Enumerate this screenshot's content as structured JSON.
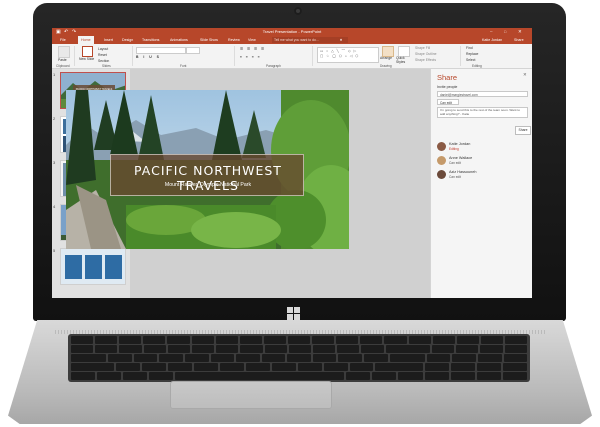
{
  "window": {
    "title": "Travel Presentation - PowerPoint",
    "user": "Katie Jordan",
    "share_label": "Share"
  },
  "tabs": [
    "File",
    "Home",
    "Insert",
    "Design",
    "Transitions",
    "Animations",
    "Slide Show",
    "Review",
    "View"
  ],
  "active_tab": "Home",
  "tell_me": {
    "placeholder": "Tell me what you want to do..."
  },
  "ribbon": {
    "paste": "Paste",
    "new_slide": "New Slide",
    "layout": "Layout",
    "reset": "Reset",
    "section": "Section",
    "arrange": "Arrange",
    "quick_styles": "Quick Styles",
    "shape_fill": "Shape Fill",
    "shape_outline": "Shape Outline",
    "shape_effects": "Shape Effects",
    "find": "Find",
    "replace": "Replace",
    "select": "Select",
    "groups": [
      "Clipboard",
      "Slides",
      "Font",
      "Paragraph",
      "Drawing",
      "Editing"
    ]
  },
  "slides": [
    {
      "number": "1",
      "caption": "PACIFIC NORTHWEST TRAVELS"
    },
    {
      "number": "2"
    },
    {
      "number": "3"
    },
    {
      "number": "4",
      "caption": "MOUNT RAINIER"
    },
    {
      "number": "5"
    }
  ],
  "current_slide": {
    "title": "PACIFIC NORTHWEST TRAVELS",
    "subtitle": "Mount Rainier, Olympic National Park"
  },
  "share_pane": {
    "title": "Share",
    "invite_label": "Invite people",
    "email": "daniel@margiestravel.com",
    "permission": "Can edit",
    "message": "I'm going to send this to the rest of the team soon. Want to add anything? - Katie",
    "share_button": "Share",
    "people": [
      {
        "name": "Katie Jordan",
        "status": "Editing",
        "color": "#c0392b",
        "avatar_color": "#8a5a44"
      },
      {
        "name": "Anne Wallace",
        "status": "Can edit",
        "color": "#555555",
        "avatar_color": "#c59a6a"
      },
      {
        "name": "Aziz Hassouneh",
        "status": "Can edit",
        "color": "#555555",
        "avatar_color": "#6b4a3a"
      }
    ]
  },
  "colors": {
    "accent": "#b7472a"
  }
}
